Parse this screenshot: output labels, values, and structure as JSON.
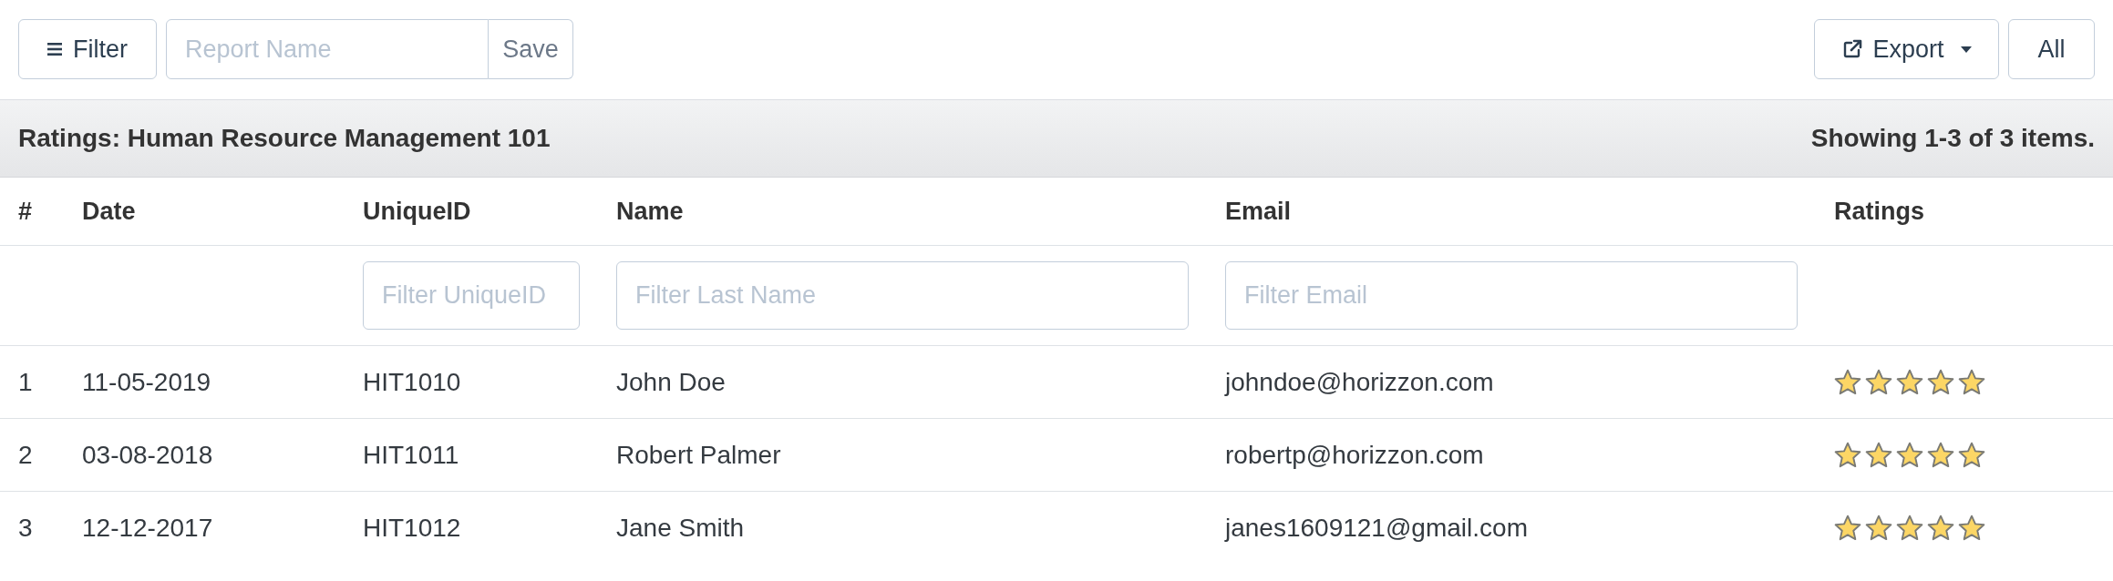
{
  "toolbar": {
    "filter_button": "Filter",
    "report_name": {
      "placeholder": "Report Name"
    },
    "save_button": "Save",
    "export_button": "Export",
    "all_button": "All"
  },
  "table": {
    "title": "Ratings: Human Resource Management 101",
    "summary": "Showing 1-3 of 3 items.",
    "columns": [
      {
        "label": "#"
      },
      {
        "label": "Date"
      },
      {
        "label": "UniqueID",
        "filter": {
          "placeholder": "Filter UniqueID"
        }
      },
      {
        "label": "Name",
        "filter": {
          "placeholder": "Filter Last Name"
        }
      },
      {
        "label": "Email",
        "filter": {
          "placeholder": "Filter Email"
        }
      },
      {
        "label": "Ratings"
      }
    ],
    "rows": [
      {
        "cells": [
          "1",
          "11-05-2019",
          "HIT1010",
          "John Doe",
          "johndoe@horizzon.com"
        ],
        "stars": 5
      },
      {
        "cells": [
          "2",
          "03-08-2018",
          "HIT1011",
          "Robert Palmer",
          "robertp@horizzon.com"
        ],
        "stars": 5
      },
      {
        "cells": [
          "3",
          "12-12-2017",
          "HIT1012",
          "Jane Smith",
          "janes1609121@gmail.com"
        ],
        "stars": 5
      }
    ]
  }
}
